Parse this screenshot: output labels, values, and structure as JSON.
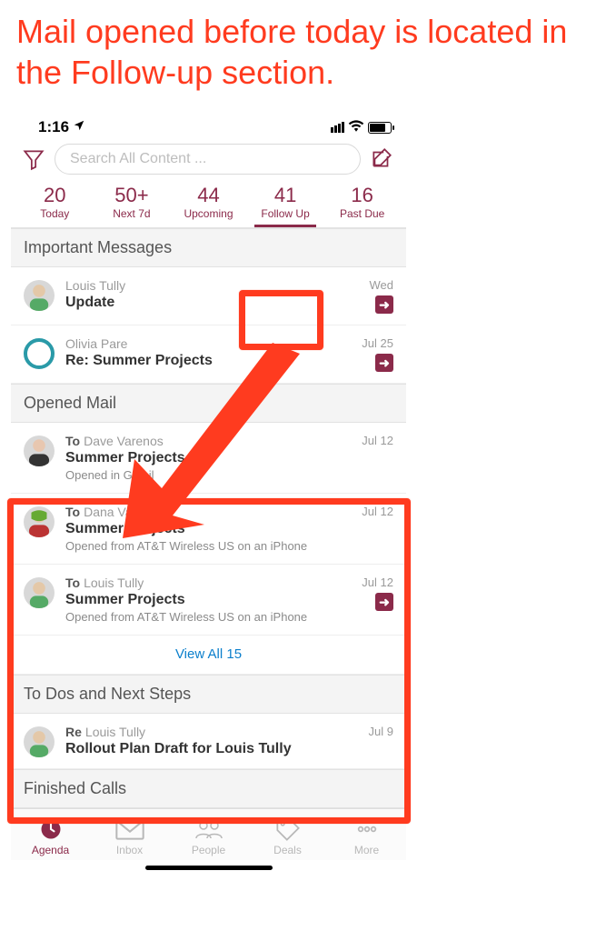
{
  "annotation_text": "Mail opened before today is located in the Follow-up section.",
  "status": {
    "time": "1:16"
  },
  "search": {
    "placeholder": "Search All Content ..."
  },
  "tabs": [
    {
      "count": "20",
      "label": "Today"
    },
    {
      "count": "50+",
      "label": "Next 7d"
    },
    {
      "count": "44",
      "label": "Upcoming"
    },
    {
      "count": "41",
      "label": "Follow Up"
    },
    {
      "count": "16",
      "label": "Past Due"
    }
  ],
  "sections": {
    "important": {
      "title": "Important Messages",
      "items": [
        {
          "from": "Louis Tully",
          "subject": "Update",
          "date": "Wed",
          "arrow": true
        },
        {
          "from": "Olivia Pare",
          "subject": "Re: Summer Projects",
          "date": "Jul 25",
          "arrow": true
        }
      ]
    },
    "opened": {
      "title": "Opened Mail",
      "items": [
        {
          "to_prefix": "To",
          "from": "Dave Varenos",
          "subject": "Summer Projects",
          "meta": "Opened in Gmail",
          "date": "Jul 12",
          "arrow": false
        },
        {
          "to_prefix": "To",
          "from": "Dana Varenos",
          "subject": "Summer Projects",
          "meta": "Opened from AT&T Wireless US on an iPhone",
          "date": "Jul 12",
          "arrow": false
        },
        {
          "to_prefix": "To",
          "from": "Louis Tully",
          "subject": "Summer Projects",
          "meta": "Opened from AT&T Wireless US on an iPhone",
          "date": "Jul 12",
          "arrow": true
        }
      ],
      "view_all": "View All 15"
    },
    "todos": {
      "title": "To Dos and Next Steps",
      "items": [
        {
          "to_prefix": "Re",
          "from": "Louis Tully",
          "subject": "Rollout Plan Draft for Louis Tully",
          "date": "Jul 9"
        }
      ]
    },
    "finished": {
      "title": "Finished Calls"
    }
  },
  "bottom_nav": [
    {
      "label": "Agenda"
    },
    {
      "label": "Inbox"
    },
    {
      "label": "People"
    },
    {
      "label": "Deals"
    },
    {
      "label": "More"
    }
  ]
}
